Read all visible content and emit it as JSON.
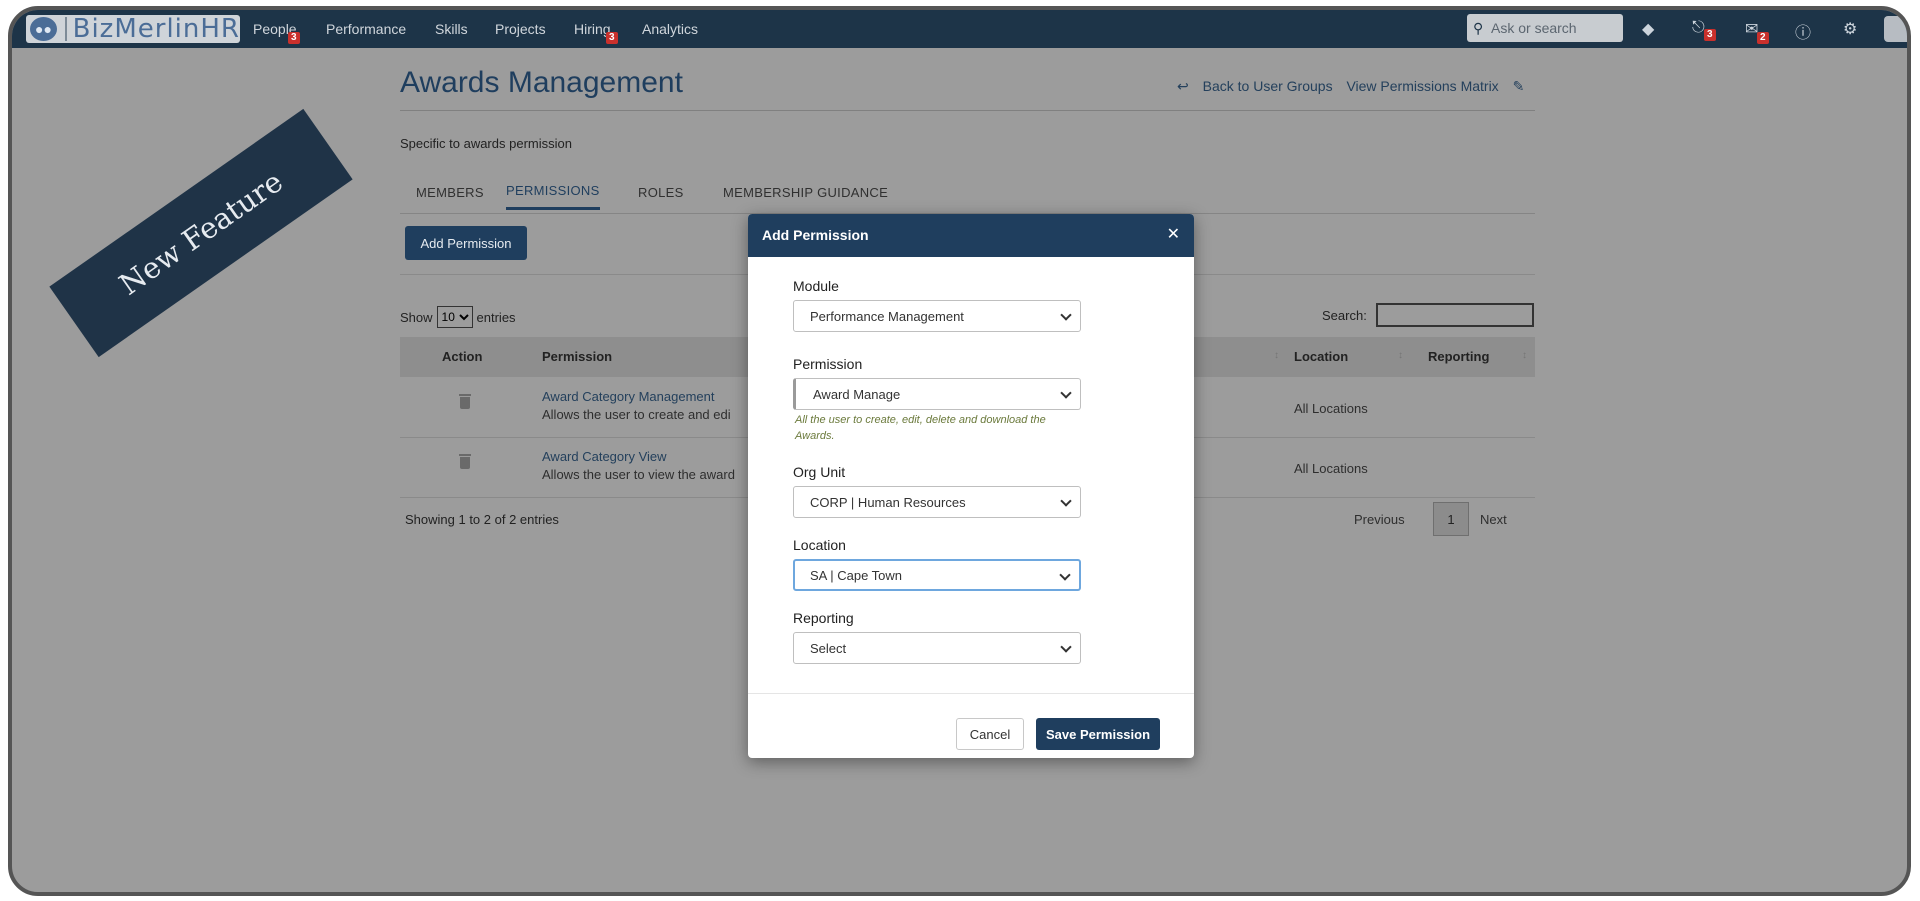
{
  "brand": {
    "name": "BizMerlinHR",
    "logo_icon": "users-logo-icon"
  },
  "nav": {
    "items": [
      {
        "label": "People",
        "badge": "3"
      },
      {
        "label": "Performance"
      },
      {
        "label": "Skills"
      },
      {
        "label": "Projects"
      },
      {
        "label": "Hiring",
        "badge": "3"
      },
      {
        "label": "Analytics"
      }
    ],
    "search_placeholder": "Ask or search",
    "icons": [
      {
        "name": "layers-icon"
      },
      {
        "name": "bell-icon",
        "badge": "3"
      },
      {
        "name": "mail-icon",
        "badge": "2"
      },
      {
        "name": "help-icon"
      },
      {
        "name": "gear-icon"
      }
    ]
  },
  "page": {
    "title": "Awards Management",
    "back_link": "Back to User Groups",
    "matrix_link": "View Permissions Matrix",
    "subtitle": "Specific to awards permission",
    "tabs": [
      "MEMBERS",
      "PERMISSIONS",
      "ROLES",
      "MEMBERSHIP GUIDANCE"
    ],
    "active_tab": "PERMISSIONS",
    "add_button": "Add Permission"
  },
  "table": {
    "show_label": "Show",
    "entries_value": "10",
    "entries_label": "entries",
    "search_label": "Search:",
    "columns": [
      "Action",
      "Permission",
      "Location",
      "Reporting"
    ],
    "rows": [
      {
        "name": "Award Category Management",
        "desc": "Allows the user to create and edi",
        "location": "All Locations"
      },
      {
        "name": "Award Category View",
        "desc": "Allows the user to view the award",
        "location": "All Locations"
      }
    ],
    "showing": "Showing 1 to 2 of 2 entries",
    "prev": "Previous",
    "page": "1",
    "next": "Next"
  },
  "ribbon": {
    "text": "New Feature"
  },
  "modal": {
    "title": "Add Permission",
    "fields": {
      "module": {
        "label": "Module",
        "value": "Performance Management"
      },
      "permission": {
        "label": "Permission",
        "value": "Award Manage",
        "hint": "All the user to create, edit, delete and download the Awards."
      },
      "org_unit": {
        "label": "Org Unit",
        "value": "CORP | Human Resources"
      },
      "location": {
        "label": "Location",
        "value": "SA | Cape Town"
      },
      "reporting": {
        "label": "Reporting",
        "value": "Select"
      }
    },
    "cancel": "Cancel",
    "save": "Save Permission"
  },
  "colors": {
    "navbar": "#1d3448",
    "primary": "#1f3e5e",
    "badge": "#c9302c",
    "overlay": "#9c9c9c"
  }
}
